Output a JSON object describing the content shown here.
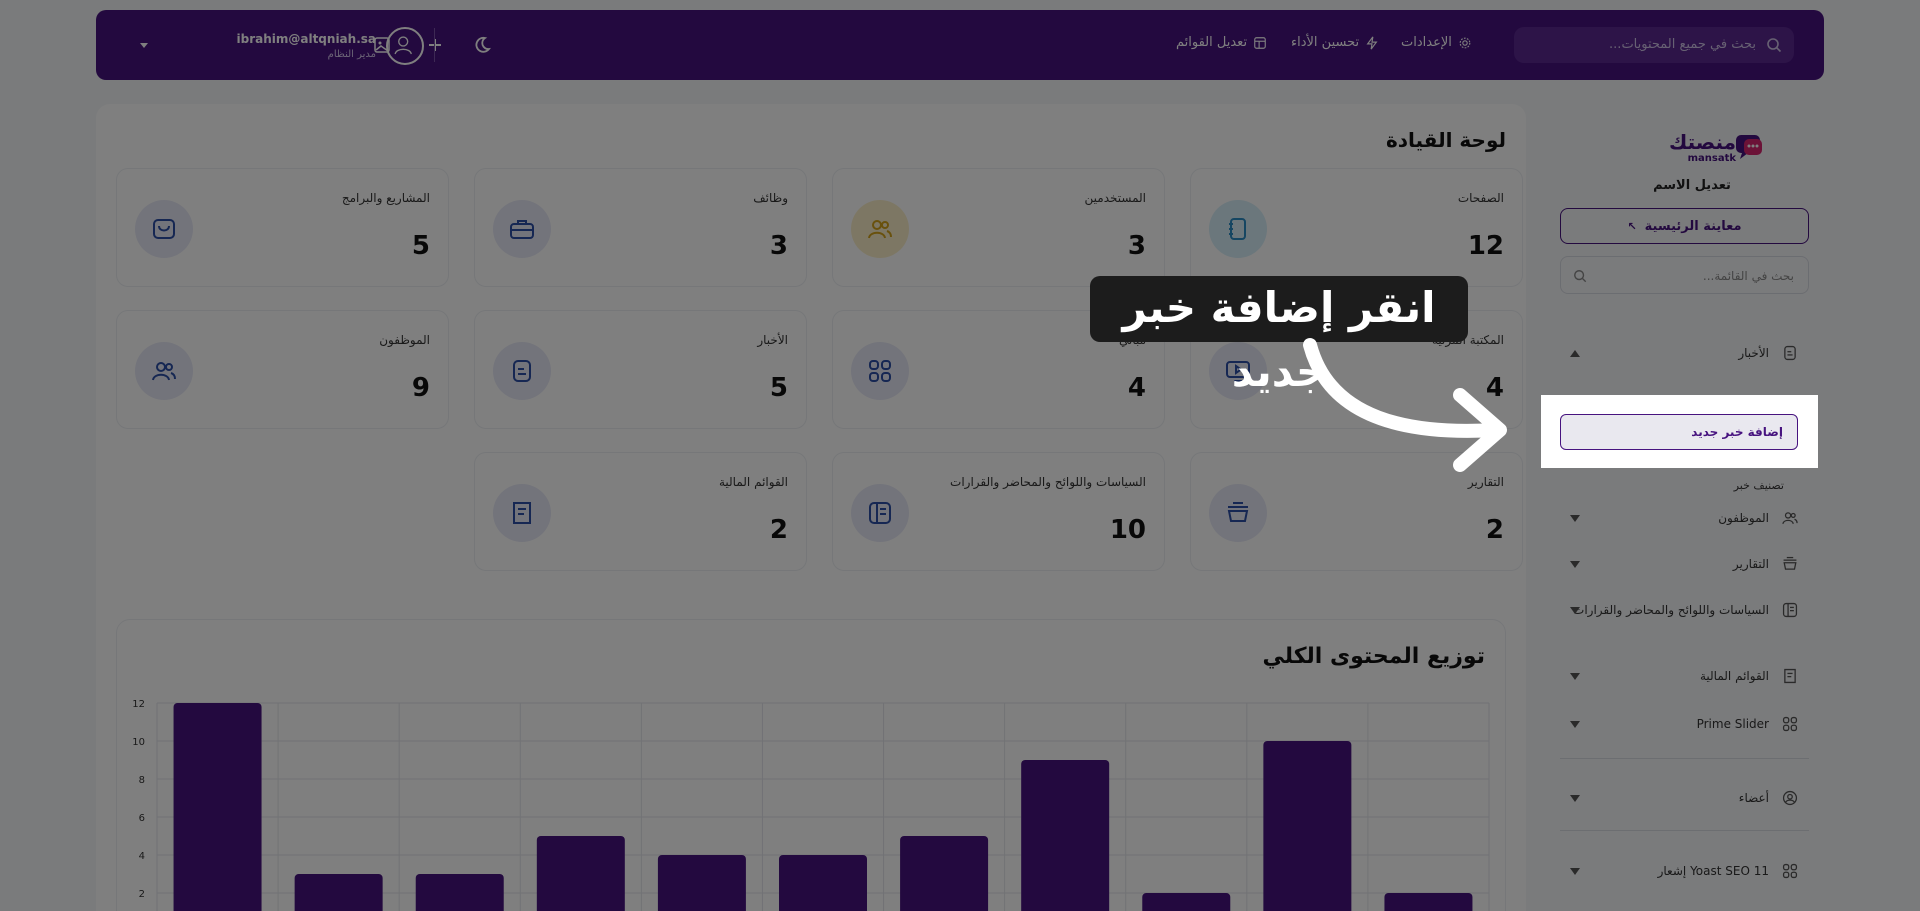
{
  "header": {
    "search_placeholder": "بحث في جميع المحتويات...",
    "nav": [
      {
        "label": "الإعدادات",
        "icon": "gear-icon"
      },
      {
        "label": "تحسين الأداء",
        "icon": "bolt-icon"
      },
      {
        "label": "تعديل القوائم",
        "icon": "layout-icon"
      }
    ],
    "user_email": "ibrahim@altqniah.sa",
    "user_role": "مدير النظام"
  },
  "main": {
    "title": "لوحة القيادة",
    "cards": [
      {
        "label": "الصفحات",
        "value": "12",
        "icon": "notebook-icon",
        "color": "#d6eef8",
        "ic": "#2a8cc4"
      },
      {
        "label": "المستخدمين",
        "value": "3",
        "icon": "users-icon",
        "color": "#fbefc9",
        "ic": "#d2a21a"
      },
      {
        "label": "وظائف",
        "value": "3",
        "icon": "briefcase-icon",
        "color": "#e6e9f6",
        "ic": "#2d4fa6"
      },
      {
        "label": "المشاريع والبرامج",
        "value": "5",
        "icon": "bag-icon",
        "color": "#e6e9f6",
        "ic": "#2d4fa6"
      },
      {
        "label": "المكتبة المرئية",
        "value": "4",
        "icon": "monitor-play-icon",
        "color": "#e6e9f6",
        "ic": "#2d4fa6"
      },
      {
        "label": "مباني",
        "value": "4",
        "icon": "grid-icon",
        "color": "#e6e9f6",
        "ic": "#2d4fa6"
      },
      {
        "label": "الأخبار",
        "value": "5",
        "icon": "news-icon",
        "color": "#e6e9f6",
        "ic": "#2d4fa6"
      },
      {
        "label": "الموظفون",
        "value": "9",
        "icon": "users-icon",
        "color": "#e6e9f6",
        "ic": "#2d4fa6"
      },
      {
        "label": "التقارير",
        "value": "2",
        "icon": "pot-icon",
        "color": "#e6e9f6",
        "ic": "#2d4fa6"
      },
      {
        "label": "السياسات واللوائح والمحاضر والقرارات",
        "value": "10",
        "icon": "book-icon",
        "color": "#e6e9f6",
        "ic": "#2d4fa6"
      },
      {
        "label": "القوائم المالية",
        "value": "2",
        "icon": "receipt-icon",
        "color": "#e6e9f6",
        "ic": "#2d4fa6"
      }
    ]
  },
  "chart_data": {
    "type": "bar",
    "title": "توزيع المحتوى الكلي",
    "values": [
      12,
      3,
      3,
      5,
      4,
      4,
      5,
      9,
      2,
      10,
      2
    ],
    "y_ticks": [
      "12",
      "10",
      "8",
      "6",
      "4",
      "2"
    ],
    "ylim": [
      0,
      12
    ],
    "grid": true,
    "bar_color": "#47137f"
  },
  "sidebar": {
    "logo_text": "منصتك",
    "logo_sub": "mansatk",
    "site_name": "تعديل الاسم",
    "preview_label": "معاينة الرئيسية",
    "search_placeholder": "بحث في القائمة...",
    "items": [
      {
        "label": "الأخبار",
        "icon": "news-icon",
        "expanded": true
      },
      {
        "label": "الموظفون",
        "icon": "users-icon"
      },
      {
        "label": "التقارير",
        "icon": "pot-icon"
      },
      {
        "label": "السياسات واللوائح والمحاضر والقرارات",
        "icon": "book-icon"
      },
      {
        "label": "القوائم المالية",
        "icon": "receipt-icon"
      },
      {
        "label": "Prime Slider",
        "icon": "grid-icon"
      },
      {
        "label": "أعضاء",
        "icon": "user-circle-icon"
      },
      {
        "label": "Yoast SEO 11 إشعار",
        "icon": "grid-icon"
      }
    ],
    "submenu_partial": "تصنيف خبر"
  },
  "overlay": {
    "callout_text": "انقر إضافة خبر جديد",
    "highlight_label": "إضافة خبر جديد"
  }
}
